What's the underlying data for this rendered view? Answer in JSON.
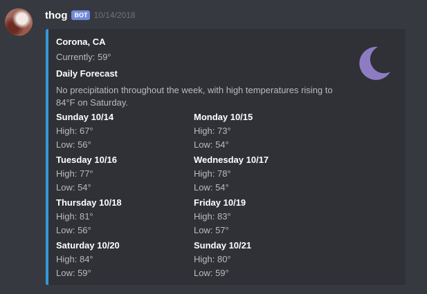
{
  "message": {
    "username": "thog",
    "bot_tag": "BOT",
    "timestamp": "10/14/2018"
  },
  "embed": {
    "accent_color": "#3498db",
    "thumbnail_icon": "crescent-moon-icon",
    "title": "Corona, CA",
    "current": "Currently: 59°",
    "field_name": "Daily Forecast",
    "summary": "No precipitation throughout the week, with high temperatures rising to 84°F on Saturday.",
    "days": [
      {
        "name": "Sunday 10/14",
        "high": "High: 67°",
        "low": "Low: 56°"
      },
      {
        "name": "Monday 10/15",
        "high": "High: 73°",
        "low": "Low: 54°"
      },
      {
        "name": "Tuesday 10/16",
        "high": "High: 77°",
        "low": "Low: 54°"
      },
      {
        "name": "Wednesday 10/17",
        "high": "High: 78°",
        "low": "Low: 54°"
      },
      {
        "name": "Thursday 10/18",
        "high": "High: 81°",
        "low": "Low: 56°"
      },
      {
        "name": "Friday 10/19",
        "high": "High: 83°",
        "low": "Low: 57°"
      },
      {
        "name": "Saturday 10/20",
        "high": "High: 84°",
        "low": "Low: 59°"
      },
      {
        "name": "Sunday 10/21",
        "high": "High: 80°",
        "low": "Low: 59°"
      }
    ]
  }
}
